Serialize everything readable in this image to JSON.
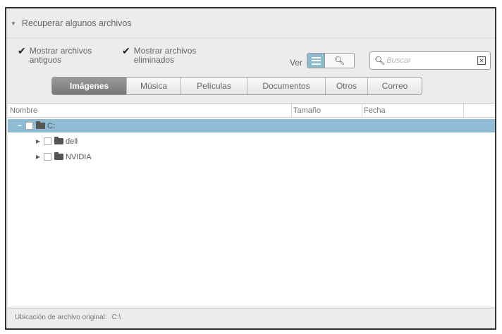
{
  "panel": {
    "title": "Recuperar algunos archivos"
  },
  "options": {
    "show_old_label": "Mostrar archivos antiguos",
    "show_old_checked": true,
    "show_deleted_label": "Mostrar archivos eliminados",
    "show_deleted_checked": true
  },
  "view": {
    "label": "Ver",
    "modes": [
      "list-icon",
      "search-icon"
    ],
    "active": "list-icon"
  },
  "search": {
    "placeholder": "Buscar",
    "value": ""
  },
  "tabs": [
    {
      "label": "Imágenes",
      "active": true
    },
    {
      "label": "Música",
      "active": false
    },
    {
      "label": "Películas",
      "active": false
    },
    {
      "label": "Documentos",
      "active": false
    },
    {
      "label": "Otros",
      "active": false
    },
    {
      "label": "Correo",
      "active": false
    }
  ],
  "table": {
    "columns": [
      "Nombre",
      "Tamaño",
      "Fecha"
    ],
    "rows": [
      {
        "name": "C:",
        "expanded": true,
        "selected": true,
        "checked": false,
        "level": 0,
        "size": "",
        "date": ""
      },
      {
        "name": "dell",
        "expanded": false,
        "selected": false,
        "checked": false,
        "level": 1,
        "size": "",
        "date": ""
      },
      {
        "name": "NVIDIA",
        "expanded": false,
        "selected": false,
        "checked": false,
        "level": 1,
        "size": "",
        "date": ""
      }
    ]
  },
  "footer": {
    "label": "Ubicación de archivo original:",
    "value": "C:\\"
  }
}
